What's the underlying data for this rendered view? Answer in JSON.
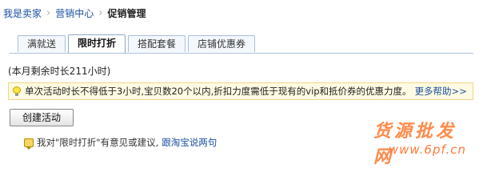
{
  "breadcrumb": {
    "items": [
      "我是卖家",
      "营销中心",
      "促销管理"
    ],
    "separator": "›"
  },
  "tabs": [
    {
      "label": "满就送",
      "active": false
    },
    {
      "label": "限时打折",
      "active": true
    },
    {
      "label": "搭配套餐",
      "active": false
    },
    {
      "label": "店铺优惠券",
      "active": false
    }
  ],
  "remaining": "(本月剩余时长211小时)",
  "notice": {
    "icon": "lightbulb-icon",
    "text": "单次活动时长不得低于3小时,宝贝数20个以内,折扣力度需低于现有的vip和抵价券的优惠力度。",
    "more_link": "更多帮助>>"
  },
  "create_button": "创建活动",
  "feedback": {
    "icon": "comment-icon",
    "text": "我对\"限时打折\"有意见或建议,",
    "link": "跟淘宝说两句"
  },
  "watermark": {
    "title": "货源批发网",
    "url": "www.6pf.cn"
  },
  "colors": {
    "link": "#1a4fa0",
    "notice_bg": "#fffbe2",
    "notice_border": "#f0d58a",
    "tab_border": "#aac0dc",
    "watermark": "#ff8a4a"
  }
}
